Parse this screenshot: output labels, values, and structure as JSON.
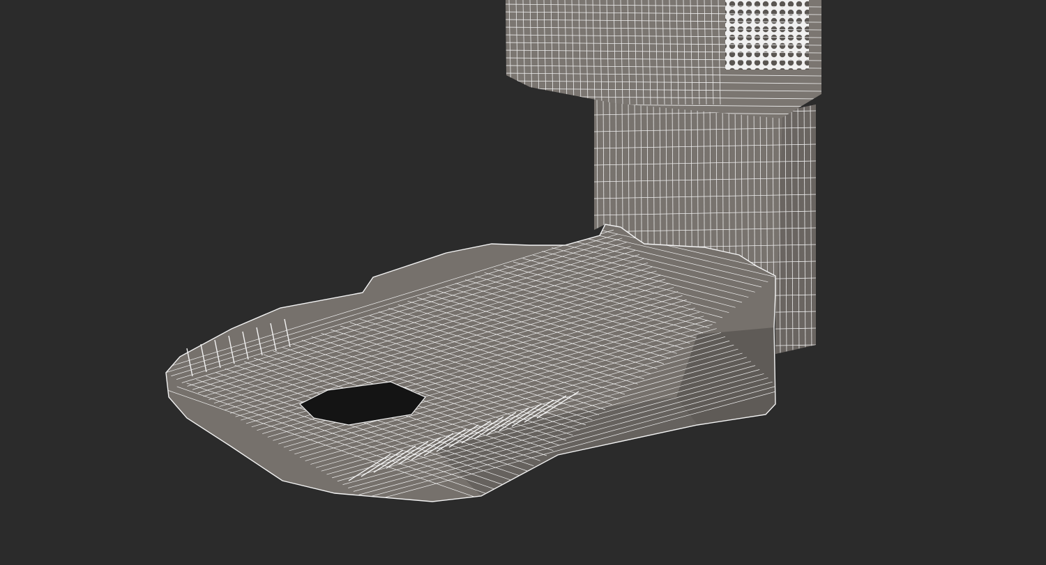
{
  "scene": {
    "subject_icon": "robot-vacuum-dock-wireframe-icon",
    "colors": {
      "background": "#2b2b2b",
      "surface": "#75706b",
      "surface_shadow": "#5f5b57",
      "surface_dark": "#4d4946",
      "wire": "#f2f2f2",
      "hole": "#141414"
    }
  }
}
